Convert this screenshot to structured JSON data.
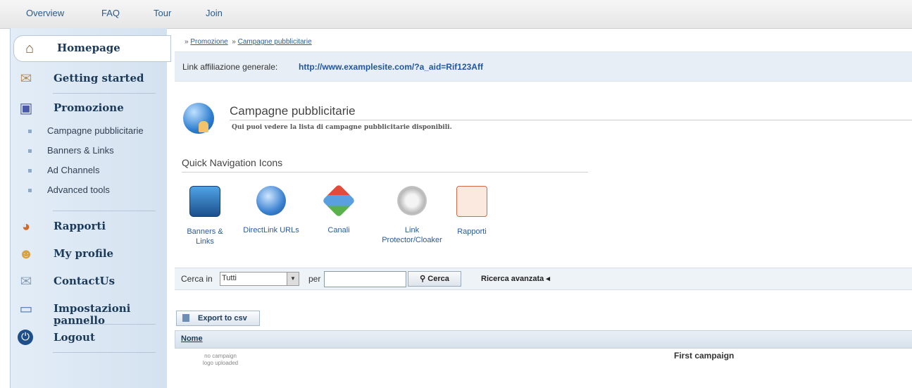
{
  "topnav": {
    "items": [
      "Overview",
      "FAQ",
      "Tour",
      "Join"
    ]
  },
  "sidebar": {
    "items": [
      {
        "label": "Homepage",
        "icon": "home-icon"
      },
      {
        "label": "Getting started",
        "icon": "getting-started-icon"
      },
      {
        "label": "Promozione",
        "icon": "promotion-icon"
      },
      {
        "label": "Rapporti",
        "icon": "reports-icon"
      },
      {
        "label": "My profile",
        "icon": "profile-icon"
      },
      {
        "label": "ContactUs",
        "icon": "envelope-icon"
      },
      {
        "label": "Impostazioni pannello",
        "icon": "settings-icon"
      },
      {
        "label": "Logout",
        "icon": "power-icon"
      }
    ],
    "subitems": [
      "Campagne pubblicitarie",
      "Banners & Links",
      "Ad Channels",
      "Advanced tools"
    ]
  },
  "breadcrumb": {
    "items": [
      "Promozione",
      "Campagne pubblicitarie"
    ],
    "sep": "»"
  },
  "affiliate": {
    "label": "Link affiliazione generale:",
    "url": "http://www.examplesite.com/?a_aid=Rif123Aff"
  },
  "page": {
    "title": "Campagne pubblicitarie",
    "subtitle": "Qui puoi vedere la lista di campagne pubblicitarie disponibili."
  },
  "quicknav": {
    "title": "Quick Navigation Icons",
    "items": [
      {
        "label": "Banners & Links",
        "icon": "banners-icon"
      },
      {
        "label": "DirectLink URLs",
        "icon": "directlink-icon"
      },
      {
        "label": "Canali",
        "icon": "channels-icon"
      },
      {
        "label": "Link Protector/Cloaker",
        "icon": "link-protector-icon"
      },
      {
        "label": "Rapporti",
        "icon": "reports-chart-icon"
      }
    ]
  },
  "search": {
    "label": "Cerca in",
    "select_value": "Tutti",
    "per_label": "per",
    "input_value": "",
    "button": "Cerca",
    "advanced": "Ricerca avanzata ◂"
  },
  "export_button": "Export to csv",
  "table": {
    "header": "Nome",
    "rows": [
      {
        "logo_text": "no campaign logo uploaded",
        "name": "First campaign"
      }
    ]
  }
}
